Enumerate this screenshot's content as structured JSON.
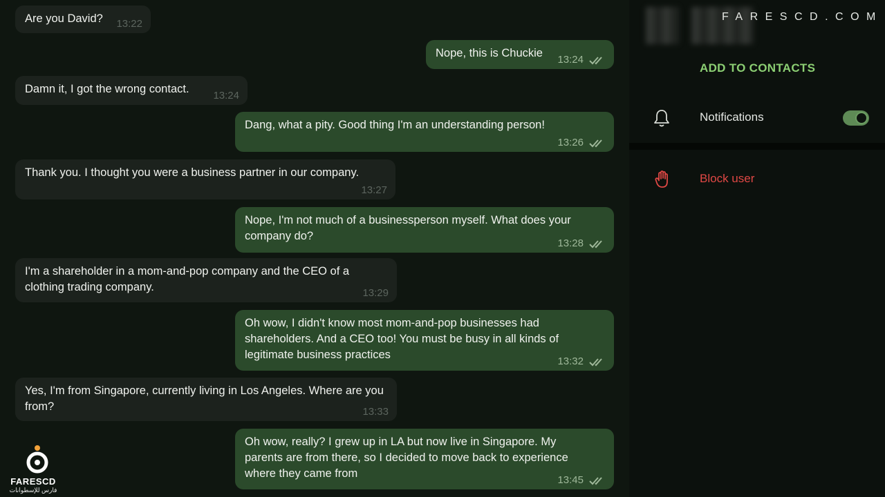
{
  "messages": [
    {
      "dir": "in",
      "text": "Are you David?",
      "time": "13:22"
    },
    {
      "dir": "out",
      "text": "Nope, this is Chuckie",
      "time": "13:24"
    },
    {
      "dir": "in",
      "text": "Damn it, I got the wrong contact.",
      "time": "13:24"
    },
    {
      "dir": "out",
      "text": "Dang, what a pity. Good thing I'm an understanding person!",
      "time": "13:26"
    },
    {
      "dir": "in",
      "text": "Thank you. I thought you were a business partner in our company.",
      "time": "13:27"
    },
    {
      "dir": "out",
      "text": "Nope, I'm not much of a businessperson myself. What does your company do?",
      "time": "13:28"
    },
    {
      "dir": "in",
      "text": "I'm a shareholder in a mom-and-pop company and the CEO of a clothing trading company.",
      "time": "13:29"
    },
    {
      "dir": "out",
      "text": "Oh wow, I didn't know most mom-and-pop businesses had shareholders. And a CEO too! You must be busy in all kinds of legitimate business practices",
      "time": "13:32"
    },
    {
      "dir": "in",
      "text": "Yes, I'm from Singapore, currently living in Los Angeles. Where are you from?",
      "time": "13:33"
    },
    {
      "dir": "out",
      "text": "Oh wow, really? I grew up in LA but now live in Singapore. My parents are from there, so I decided to move back to experience where they came from",
      "time": "13:45"
    }
  ],
  "sidebar": {
    "brand": "FARESCD.COM",
    "add_contacts": "ADD TO CONTACTS",
    "notifications_label": "Notifications",
    "notifications_on": true,
    "block_label": "Block user"
  },
  "logo": {
    "name": "FARESCD",
    "subtitle": "فارس للإسطوانات"
  },
  "colors": {
    "incoming_bubble": "#1c221d",
    "outgoing_bubble": "#2b4a2b",
    "accent_green": "#8ccf73",
    "danger_red": "#e04845"
  },
  "icons": {
    "read_receipt": "double-check-icon",
    "notifications": "bell-icon",
    "block": "hand-stop-icon"
  }
}
